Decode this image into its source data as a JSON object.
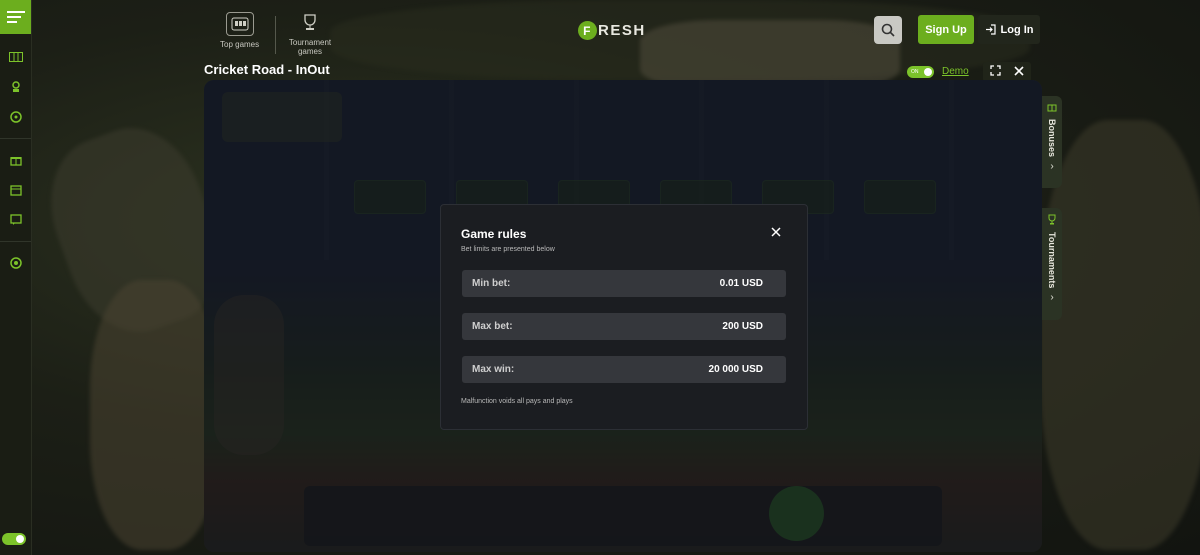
{
  "header": {
    "nav": [
      {
        "label": "Top games",
        "icon": "top-games-icon"
      },
      {
        "label": "Tournament games",
        "icon": "trophy-icon"
      }
    ],
    "logo_letter": "F",
    "logo_rest": "RESH",
    "signup_label": "Sign Up",
    "login_label": "Log In"
  },
  "game": {
    "title": "Cricket Road - InOut",
    "demo_toggle_text": "ON",
    "demo_label": "Demo"
  },
  "side_tabs": {
    "bonuses": "Bonuses",
    "tournaments": "Tournaments"
  },
  "modal": {
    "title": "Game rules",
    "subtitle": "Bet limits are presented below",
    "rows": [
      {
        "label": "Min bet:",
        "value": "0.01 USD"
      },
      {
        "label": "Max bet:",
        "value": "200 USD"
      },
      {
        "label": "Max win:",
        "value": "20 000 USD"
      }
    ],
    "footer": "Malfunction voids all pays and plays"
  },
  "colors": {
    "accent": "#6cae1e",
    "modal_bg": "#1b1d21",
    "row_bg": "#35373c"
  }
}
